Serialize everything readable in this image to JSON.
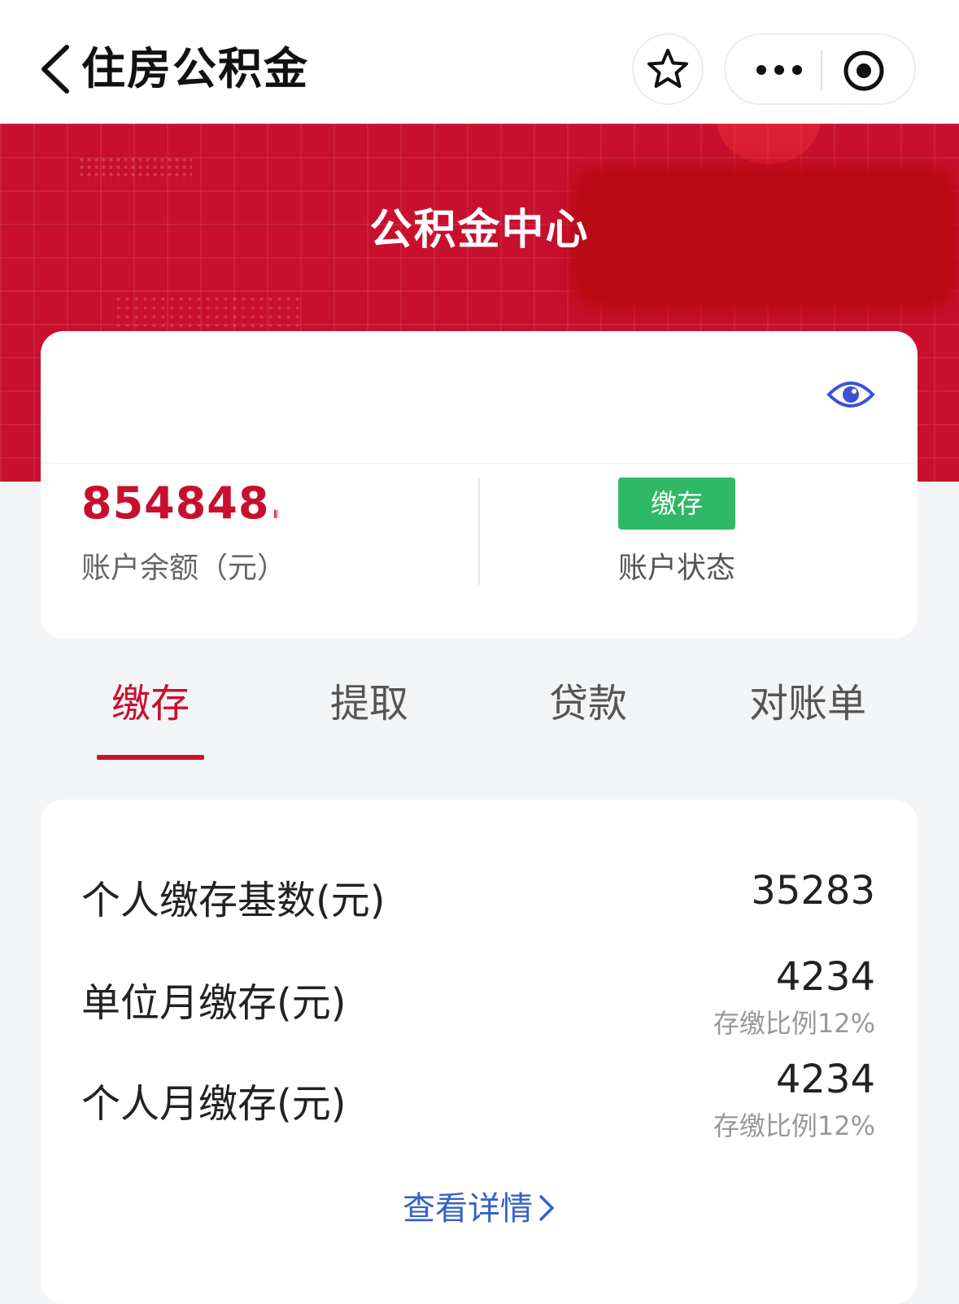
{
  "navbar": {
    "title": "住房公积金",
    "back_icon": "chevron-left-icon",
    "star_icon": "star-icon",
    "more_icon": "more-dots-icon",
    "close_icon": "target-icon"
  },
  "banner": {
    "title": "公积金中心",
    "color": "#c8102e"
  },
  "account": {
    "balance": "854848.",
    "balance_label": "账户余额（元）",
    "status_badge": "缴存",
    "status_badge_color": "#2fb865",
    "status_label": "账户状态",
    "visibility_icon": "eye-icon"
  },
  "tabs": [
    {
      "label": "缴存",
      "active": true
    },
    {
      "label": "提取",
      "active": false
    },
    {
      "label": "贷款",
      "active": false
    },
    {
      "label": "对账单",
      "active": false
    }
  ],
  "contribution": {
    "rows": [
      {
        "label": "个人缴存基数(元)",
        "value": "35283",
        "sub": ""
      },
      {
        "label": "单位月缴存(元)",
        "value": "4234",
        "sub": "存缴比例12%"
      },
      {
        "label": "个人月缴存(元)",
        "value": "4234",
        "sub": "存缴比例12%"
      }
    ],
    "detail_link": "查看详情",
    "link_color": "#3560c8"
  }
}
